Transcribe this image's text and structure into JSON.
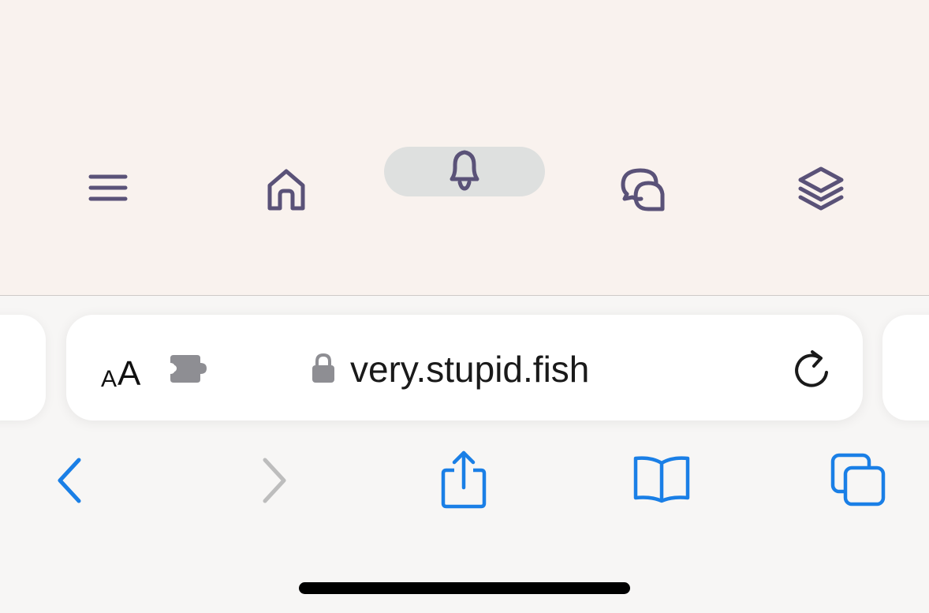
{
  "app_nav": {
    "items": [
      {
        "icon": "menu-icon"
      },
      {
        "icon": "home-icon"
      },
      {
        "icon": "bell-icon",
        "active": true
      },
      {
        "icon": "chat-bubbles-icon"
      },
      {
        "icon": "layers-icon"
      }
    ],
    "icon_color": "#5a5278",
    "active_pill_color": "#dee0df",
    "background": "#f9f2ee"
  },
  "address_bar": {
    "text_size_small": "A",
    "text_size_large": "A",
    "extension_icon": "puzzle-piece-icon",
    "secure": true,
    "url": "very.stupid.fish",
    "reload_icon": "reload-icon"
  },
  "toolbar": {
    "back_enabled": true,
    "forward_enabled": false,
    "items": [
      "back-icon",
      "forward-icon",
      "share-icon",
      "bookmarks-icon",
      "tabs-icon"
    ],
    "accent_color": "#1a7fe6",
    "disabled_color": "#bdbdbd"
  }
}
